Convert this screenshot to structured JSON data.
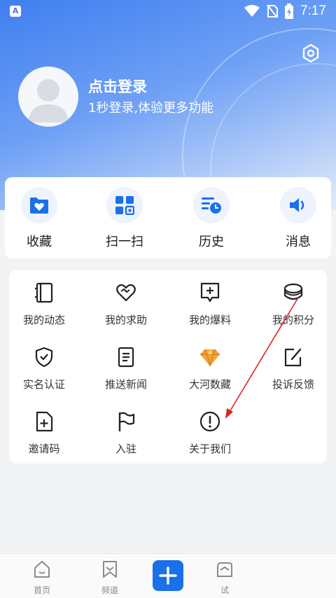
{
  "status_bar": {
    "app_badge": "A",
    "time": "7:17"
  },
  "profile": {
    "login_title": "点击登录",
    "login_subtitle": "1秒登录,体验更多功能"
  },
  "quick_actions": [
    {
      "label": "收藏",
      "icon": "heart-folder-icon"
    },
    {
      "label": "扫一扫",
      "icon": "scan-icon"
    },
    {
      "label": "历史",
      "icon": "history-icon"
    },
    {
      "label": "消息",
      "icon": "speaker-icon"
    }
  ],
  "features": [
    {
      "label": "我的动态",
      "icon": "notebook-icon"
    },
    {
      "label": "我的求助",
      "icon": "heart-hands-icon"
    },
    {
      "label": "我的爆料",
      "icon": "add-message-icon"
    },
    {
      "label": "我的积分",
      "icon": "coins-icon"
    },
    {
      "label": "实名认证",
      "icon": "shield-check-icon"
    },
    {
      "label": "推送新闻",
      "icon": "document-icon"
    },
    {
      "label": "大河数藏",
      "icon": "diamond-icon"
    },
    {
      "label": "投诉反馈",
      "icon": "edit-icon"
    },
    {
      "label": "邀请码",
      "icon": "file-plus-icon"
    },
    {
      "label": "入驻",
      "icon": "flag-icon"
    },
    {
      "label": "关于我们",
      "icon": "info-icon"
    }
  ],
  "tab_bar": [
    {
      "label": "首页",
      "icon": "home-icon"
    },
    {
      "label": "频道",
      "icon": "bookmark-icon"
    },
    {
      "label": "",
      "icon": "plus-icon"
    },
    {
      "label": "试",
      "icon": "tab-icon"
    }
  ],
  "colors": {
    "accent": "#1971e9",
    "annotation_arrow": "#e02020"
  }
}
